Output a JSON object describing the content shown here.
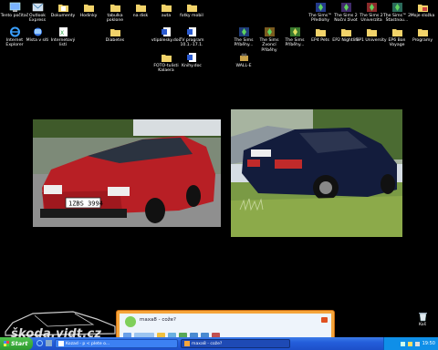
{
  "desktop_icons": [
    {
      "label": "Tento počítač",
      "icon": "my-computer-icon"
    },
    {
      "label": "Outlook\nExpress",
      "icon": "outlook-express-icon"
    },
    {
      "label": "Dokumenty",
      "icon": "documents-folder-icon"
    },
    {
      "label": "Hodinky",
      "icon": "folder-icon"
    },
    {
      "label": "tabulka\npoklone",
      "icon": "folder-icon"
    },
    {
      "label": "na disk",
      "icon": "folder-icon"
    },
    {
      "label": "auta",
      "icon": "folder-icon"
    },
    {
      "label": "fotky mobil",
      "icon": "folder-icon"
    },
    {
      "label": "Internet\nExplorer",
      "icon": "internet-explorer-icon"
    },
    {
      "label": "Místa v síti",
      "icon": "network-places-icon"
    },
    {
      "label": "Internetový\nlistí",
      "icon": "internet-shortcut-icon"
    },
    {
      "label": "Diabetes",
      "icon": "folder-icon"
    },
    {
      "label": "vtipálesky.doc",
      "icon": "word-document-icon"
    },
    {
      "label": "TV program\n10.1.-17.1.",
      "icon": "word-document-icon"
    },
    {
      "label": "FOTO-tulisti\nKalaera",
      "icon": "folder-icon"
    },
    {
      "label": "Knihy.doc",
      "icon": "word-document-icon"
    },
    {
      "label": "The Sims™\nPředlohy",
      "icon": "sims-icon"
    },
    {
      "label": "The Sims 2\nNoční život",
      "icon": "sims-icon"
    },
    {
      "label": "The Sims 2\nUniverzita",
      "icon": "sims-icon"
    },
    {
      "label": "The Sims™ 2\nŠťastnou...",
      "icon": "sims-icon"
    },
    {
      "label": "Moje složka",
      "icon": "folder-icon"
    },
    {
      "label": "The Sims\nPříběhy...",
      "icon": "sims-icon"
    },
    {
      "label": "The Sims\nZvoncí Příběhy",
      "icon": "sims-icon"
    },
    {
      "label": "The Sims\nPříběhy...",
      "icon": "sims-icon"
    },
    {
      "label": "EP4 Pets",
      "icon": "folder-icon"
    },
    {
      "label": "EP2 Nightlife",
      "icon": "folder-icon"
    },
    {
      "label": "EP1 University",
      "icon": "folder-icon"
    },
    {
      "label": "EP6 Bon\nVoyage",
      "icon": "folder-icon"
    },
    {
      "label": "Programy",
      "icon": "folder-icon"
    },
    {
      "label": "WALL-E",
      "icon": "wall-e-icon"
    },
    {
      "label": "Koš",
      "icon": "recycle-bin-icon"
    }
  ],
  "photos": [
    {
      "desc": "red-car-photo",
      "plate": "1ZBS 3994"
    },
    {
      "desc": "blue-car-photo",
      "plate": ""
    }
  ],
  "watermark": {
    "text": "škoda.vidt.cz"
  },
  "chat_window": {
    "title": "maxa8 - cože?"
  },
  "taskbar": {
    "start_label": "Start",
    "tasks": [
      {
        "label": "Kozad - p < plete o...",
        "active": false
      },
      {
        "label": "maxa8 - cože?",
        "active": true
      }
    ],
    "clock": "19:50"
  },
  "colors": {
    "taskbar": "#245edb",
    "start": "#2e9a2e",
    "chat_border": "#f6a53a"
  }
}
